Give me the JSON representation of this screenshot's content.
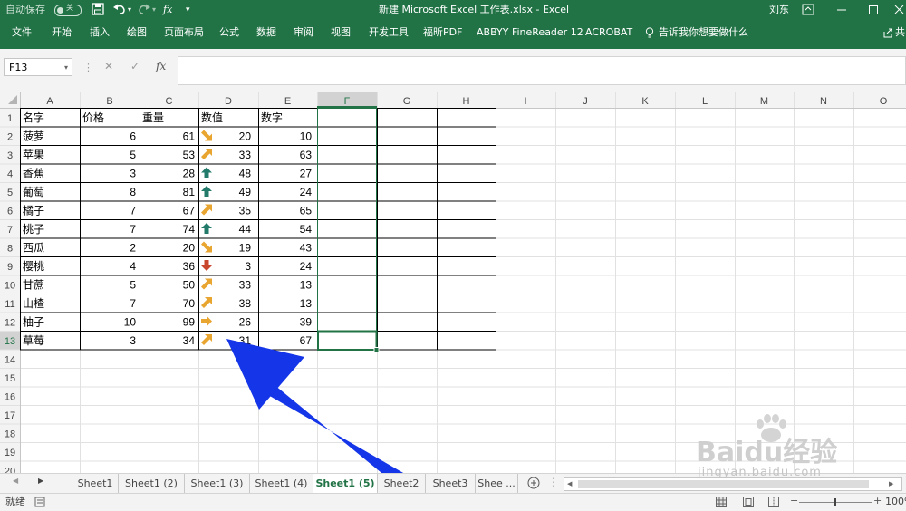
{
  "title_bar": {
    "autosave_label": "自动保存",
    "autosave_state": "关",
    "document_title": "新建 Microsoft Excel 工作表.xlsx  -  Excel",
    "user_name": "刘东",
    "qat_icons": [
      "save-icon",
      "undo-icon",
      "redo-icon",
      "fx-icon",
      "customize-icon"
    ]
  },
  "ribbon_tabs": [
    "文件",
    "开始",
    "插入",
    "绘图",
    "页面布局",
    "公式",
    "数据",
    "审阅",
    "视图",
    "开发工具",
    "福昕PDF",
    "ABBYY FineReader 12",
    "ACROBAT"
  ],
  "tell_me": "告诉我你想要做什么",
  "share_label": "共",
  "name_box": "F13",
  "fx_label": "fx",
  "column_letters": [
    "A",
    "B",
    "C",
    "D",
    "E",
    "F",
    "G",
    "H",
    "I",
    "J",
    "K",
    "L",
    "M",
    "N",
    "O"
  ],
  "row_numbers": [
    "1",
    "2",
    "3",
    "4",
    "5",
    "6",
    "7",
    "8",
    "9",
    "10",
    "11",
    "12",
    "13",
    "14",
    "15",
    "16",
    "17",
    "18",
    "19",
    "20"
  ],
  "headers": [
    "名字",
    "价格",
    "重量",
    "数值",
    "数字"
  ],
  "rows": [
    {
      "name": "菠萝",
      "price": "6",
      "weight": "61",
      "icon": "arrow-down-right-icon",
      "icon_color": "#e8a530",
      "value": "20",
      "number": "10"
    },
    {
      "name": "苹果",
      "price": "5",
      "weight": "53",
      "icon": "arrow-up-right-icon",
      "icon_color": "#e8a530",
      "value": "33",
      "number": "63"
    },
    {
      "name": "香蕉",
      "price": "3",
      "weight": "28",
      "icon": "arrow-up-icon",
      "icon_color": "#217a6a",
      "value": "48",
      "number": "27"
    },
    {
      "name": "葡萄",
      "price": "8",
      "weight": "81",
      "icon": "arrow-up-icon",
      "icon_color": "#217a6a",
      "value": "49",
      "number": "24"
    },
    {
      "name": "橘子",
      "price": "7",
      "weight": "67",
      "icon": "arrow-up-right-icon",
      "icon_color": "#e8a530",
      "value": "35",
      "number": "65"
    },
    {
      "name": "桃子",
      "price": "7",
      "weight": "74",
      "icon": "arrow-up-icon",
      "icon_color": "#217a6a",
      "value": "44",
      "number": "54"
    },
    {
      "name": "西瓜",
      "price": "2",
      "weight": "20",
      "icon": "arrow-down-right-icon",
      "icon_color": "#e8a530",
      "value": "19",
      "number": "43"
    },
    {
      "name": "樱桃",
      "price": "4",
      "weight": "36",
      "icon": "arrow-down-icon",
      "icon_color": "#c8462c",
      "value": "3",
      "number": "24"
    },
    {
      "name": "甘蔗",
      "price": "5",
      "weight": "50",
      "icon": "arrow-up-right-icon",
      "icon_color": "#e8a530",
      "value": "33",
      "number": "13"
    },
    {
      "name": "山楂",
      "price": "7",
      "weight": "70",
      "icon": "arrow-up-right-icon",
      "icon_color": "#e8a530",
      "value": "38",
      "number": "13"
    },
    {
      "name": "柚子",
      "price": "10",
      "weight": "99",
      "icon": "arrow-right-icon",
      "icon_color": "#e8a530",
      "value": "26",
      "number": "39"
    },
    {
      "name": "草莓",
      "price": "3",
      "weight": "34",
      "icon": "arrow-up-right-icon",
      "icon_color": "#e8a530",
      "value": "31",
      "number": "67"
    }
  ],
  "sheet_tabs": [
    "Sheet1",
    "Sheet1 (2)",
    "Sheet1 (3)",
    "Sheet1 (4)",
    "Sheet1 (5)",
    "Sheet2",
    "Sheet3",
    "Shee ..."
  ],
  "active_sheet": "Sheet1 (5)",
  "status": {
    "ready": "就绪",
    "zoom": "100%"
  },
  "watermark": {
    "brand": "Baidu经验",
    "url": "jingyan.baidu.com"
  },
  "colors": {
    "excel_green": "#217346",
    "annotation_arrow": "#1535e8",
    "gridline": "#e1e1e1",
    "header_bg": "#f3f3f3"
  }
}
